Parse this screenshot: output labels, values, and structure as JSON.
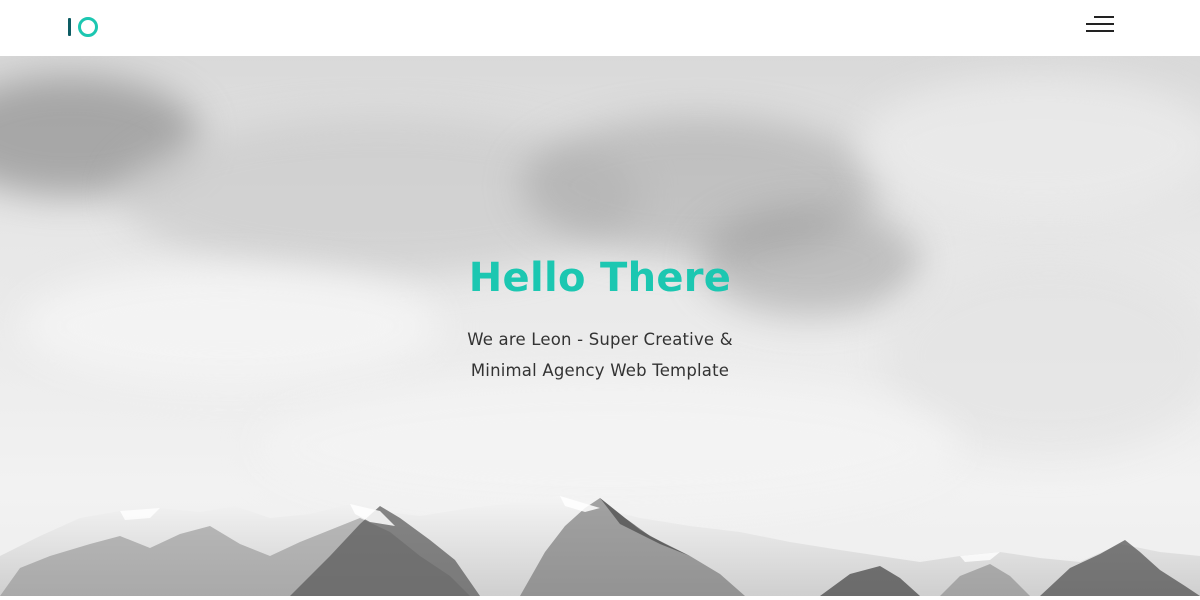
{
  "header": {
    "logo_text": "IO",
    "menu_icon": "hamburger-menu-icon"
  },
  "hero": {
    "title": "Hello There",
    "subtitle_line1": "We are Leon - Super Creative &",
    "subtitle_line2": "Minimal Agency Web Template",
    "background": "black-and-white snowy mountain range under cloudy sky"
  },
  "colors": {
    "accent": "#1cc7b1",
    "logo_bar": "#0d5c63",
    "text": "#333333",
    "header_bg": "#ffffff"
  }
}
